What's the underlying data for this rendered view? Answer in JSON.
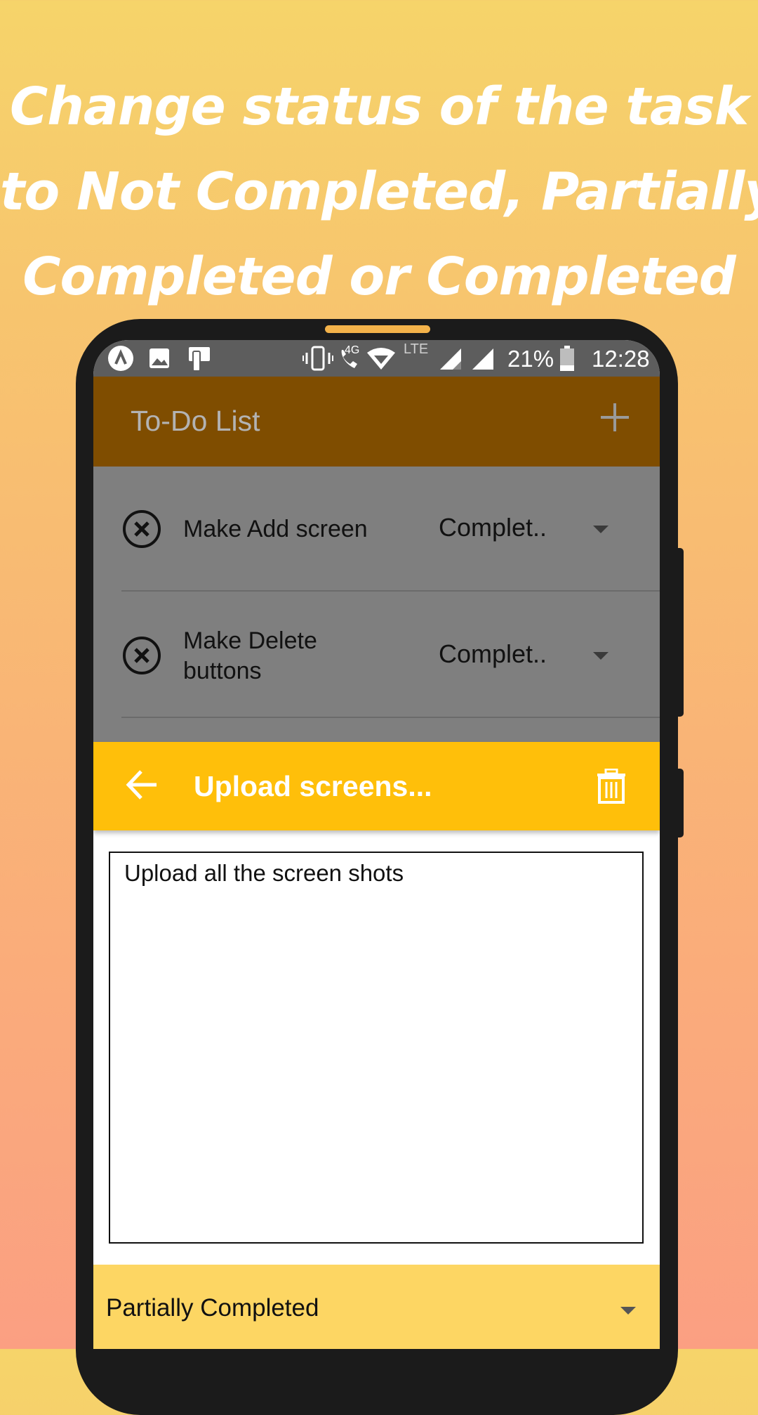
{
  "promo": {
    "headline_lines": [
      "Change status of the task",
      "to Not Completed, Partially",
      "Completed or Completed"
    ]
  },
  "statusbar": {
    "time": "12:28",
    "battery": "21%",
    "network_4g": "4G",
    "network_lte": "LTE",
    "icons": [
      "launcher-icon",
      "image-icon",
      "cast-icon",
      "vibrate-icon",
      "call-icon",
      "wifi-icon",
      "signal-icon",
      "signal-icon",
      "battery-icon"
    ]
  },
  "appbar": {
    "title": "To-Do List",
    "add_icon": "plus-icon",
    "background": "#7f4d00"
  },
  "tasks": [
    {
      "name": "Make Add screen",
      "status": "Complet.."
    },
    {
      "name": "Make Delete buttons",
      "status": "Complet.."
    }
  ],
  "detail": {
    "title": "Upload screens...",
    "back_icon": "arrow-left-icon",
    "delete_icon": "trash-icon",
    "background": "#ffbf0a",
    "notes": "Upload all the screen shots",
    "status_value": "Partially Completed",
    "status_background": "#fdd663"
  }
}
